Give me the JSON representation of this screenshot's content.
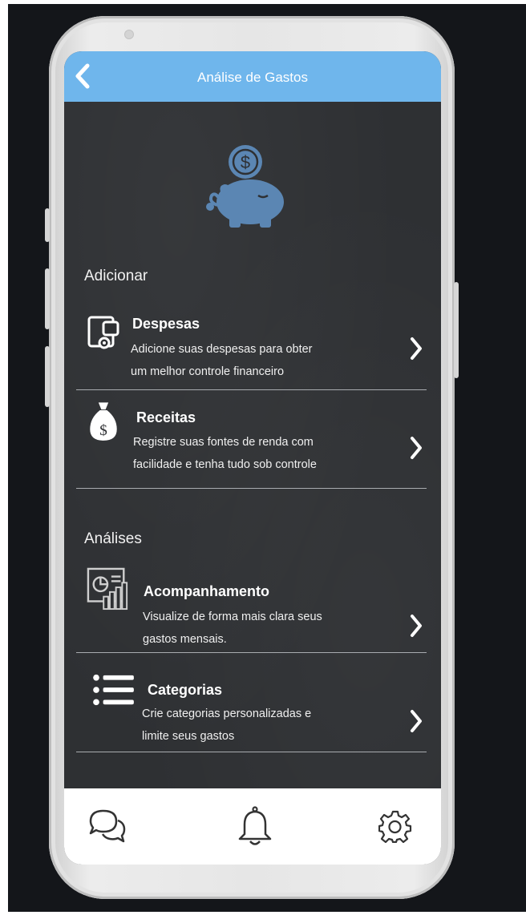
{
  "header": {
    "title": "Análise de Gastos"
  },
  "sections": [
    {
      "label": "Adicionar"
    },
    {
      "label": "Análises"
    }
  ],
  "rows": [
    {
      "title": "Despesas",
      "desc_line1": "Adicione suas despesas para obter",
      "desc_line2": "um melhor controle financeiro",
      "icon": "wallet-icon"
    },
    {
      "title": "Receitas",
      "desc_line1": "Registre suas fontes de renda com",
      "desc_line2": "facilidade e tenha tudo sob controle",
      "icon": "money-bag-icon"
    },
    {
      "title": "Acompanhamento",
      "desc_line1": "Visualize de forma mais clara seus",
      "desc_line2": "gastos mensais.",
      "icon": "report-chart-icon"
    },
    {
      "title": "Categorias",
      "desc_line1": "Crie categorias personalizadas e",
      "desc_line2": "limite seus gastos",
      "icon": "list-icon"
    }
  ],
  "hero_icon": "piggy-bank-icon",
  "hero_symbol": "$",
  "bag_symbol": "$",
  "bottom_nav": [
    "chat-icon",
    "bell-icon",
    "gear-icon"
  ],
  "colors": {
    "header": "#6fb6ec",
    "screen_bg": "#2e3033",
    "accent_icon": "#5b86b3"
  }
}
